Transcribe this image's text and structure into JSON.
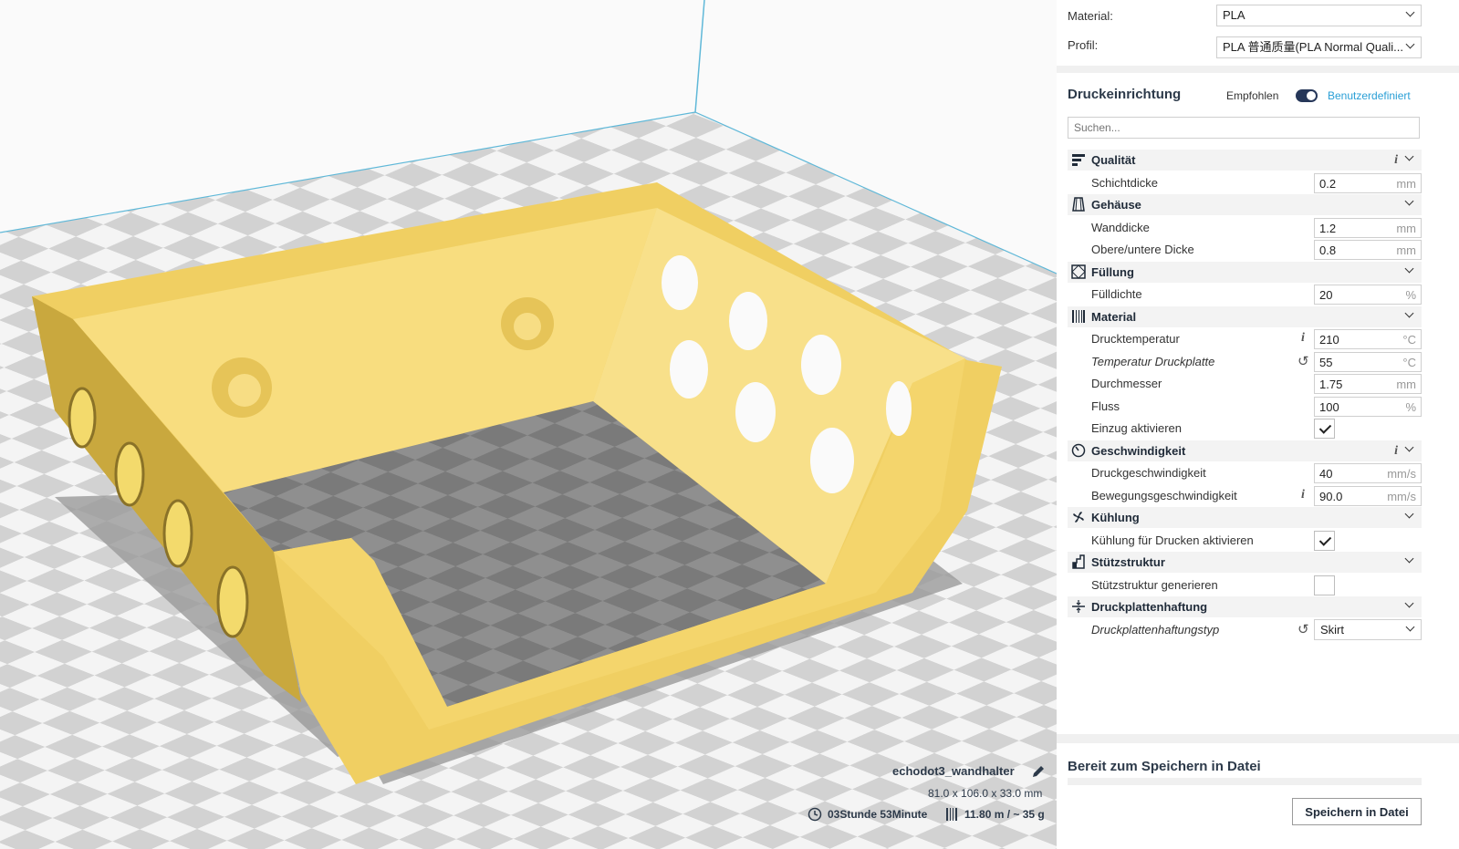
{
  "panel": {
    "material_label": "Material:",
    "material_value": "PLA",
    "profile_label": "Profil:",
    "profile_value": "PLA 普通质量(PLA Normal Quali...",
    "setup_title": "Druckeinrichtung",
    "mode_recommended": "Empfohlen",
    "mode_custom": "Benutzerdefiniert",
    "search_placeholder": "Suchen...",
    "ready_text": "Bereit zum Speichern in Datei",
    "save_button": "Speichern in Datei",
    "categories": {
      "quality": "Qualität",
      "shell": "Gehäuse",
      "infill": "Füllung",
      "material": "Material",
      "speed": "Geschwindigkeit",
      "cooling": "Kühlung",
      "support": "Stützstruktur",
      "adhesion": "Druckplattenhaftung"
    },
    "settings": {
      "layer_height": {
        "label": "Schichtdicke",
        "value": "0.2",
        "unit": "mm"
      },
      "wall_thickness": {
        "label": "Wanddicke",
        "value": "1.2",
        "unit": "mm"
      },
      "top_bottom": {
        "label": "Obere/untere Dicke",
        "value": "0.8",
        "unit": "mm"
      },
      "infill_density": {
        "label": "Fülldichte",
        "value": "20",
        "unit": "%"
      },
      "print_temp": {
        "label": "Drucktemperatur",
        "value": "210",
        "unit": "°C"
      },
      "bed_temp": {
        "label": "Temperatur Druckplatte",
        "value": "55",
        "unit": "°C"
      },
      "diameter": {
        "label": "Durchmesser",
        "value": "1.75",
        "unit": "mm"
      },
      "flow": {
        "label": "Fluss",
        "value": "100",
        "unit": "%"
      },
      "retraction": {
        "label": "Einzug aktivieren",
        "checked": true
      },
      "print_speed": {
        "label": "Druckgeschwindigkeit",
        "value": "40",
        "unit": "mm/s"
      },
      "travel_speed": {
        "label": "Bewegungsgeschwindigkeit",
        "value": "90.0",
        "unit": "mm/s"
      },
      "cooling_enable": {
        "label": "Kühlung für Drucken aktivieren",
        "checked": true
      },
      "support_enable": {
        "label": "Stützstruktur generieren",
        "checked": false
      },
      "adhesion_type": {
        "label": "Druckplattenhaftungstyp",
        "value": "Skirt"
      }
    }
  },
  "viewport": {
    "object_name": "echodot3_wandhalter",
    "dimensions": "81.0 x 106.0 x 33.0 mm",
    "print_time": "03Stunde 53Minute",
    "material_usage": "11.80 m / ~ 35 g"
  },
  "colors": {
    "model_yellow": "#f6d873",
    "accent_blue": "#2a9fd6",
    "toggle_navy": "#263759"
  }
}
